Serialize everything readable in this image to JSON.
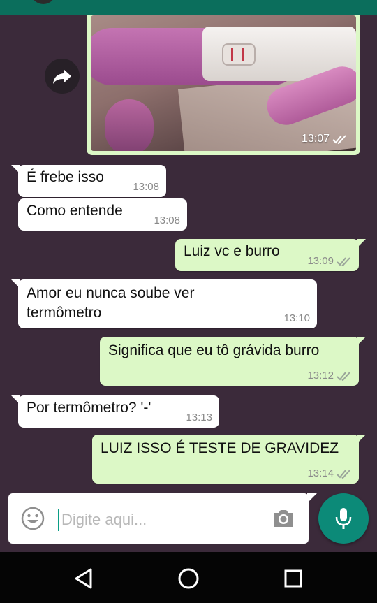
{
  "colors": {
    "header": "#0b6e5c",
    "chat_background": "#3b2a3a",
    "incoming_bubble": "#ffffff",
    "outgoing_bubble": "#dcf8c6",
    "mic_button": "#0c8a78",
    "nav_bar": "#050505"
  },
  "image_message": {
    "time": "13:07",
    "status_icon": "double-check-icon",
    "forward_icon": "forward-icon"
  },
  "messages": [
    {
      "direction": "in",
      "text": "É frebe isso",
      "time": "13:08"
    },
    {
      "direction": "in",
      "text": "Como entende",
      "time": "13:08"
    },
    {
      "direction": "out",
      "text": "Luiz vc e burro",
      "time": "13:09"
    },
    {
      "direction": "in",
      "text": "Amor eu nunca soube ver termômetro",
      "time": "13:10"
    },
    {
      "direction": "out",
      "text": "Significa que eu tô grávida burro",
      "time": "13:12"
    },
    {
      "direction": "in",
      "text": "Por termômetro? '-'",
      "time": "13:13"
    },
    {
      "direction": "out",
      "text": "LUIZ ISSO É TESTE DE GRAVIDEZ",
      "time": "13:14"
    }
  ],
  "composer": {
    "placeholder": "Digite aqui...",
    "emoji_icon": "emoji-icon",
    "camera_icon": "camera-icon",
    "mic_icon": "mic-icon"
  },
  "navigation": {
    "back_icon": "back-triangle-icon",
    "home_icon": "home-circle-icon",
    "recents_icon": "recents-square-icon"
  }
}
